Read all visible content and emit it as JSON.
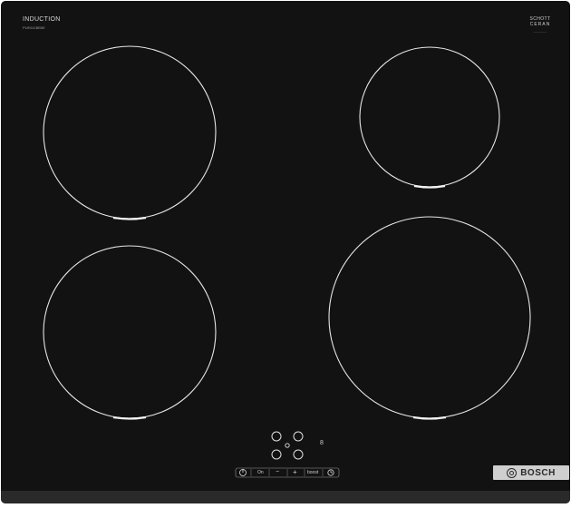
{
  "product": {
    "type_label": "INDUCTION",
    "model_label": "PUE611BB5E",
    "glass_brand_top": "SCHOTT",
    "glass_brand_bottom": "CERAN",
    "glass_brand_small": "—————",
    "brand": "BOSCH"
  },
  "controls": {
    "power_label": "On",
    "minus_label": "−",
    "plus_label": "+",
    "boost_label": "boost",
    "timer_icon": "clock-icon",
    "power_icon": "power-icon",
    "zone_select_icon": "zone-selector-icon",
    "display_value": "8"
  },
  "colors": {
    "glass": "#121212",
    "zone_outline": "#e6e6e6",
    "badge": "#cfcfcf"
  }
}
